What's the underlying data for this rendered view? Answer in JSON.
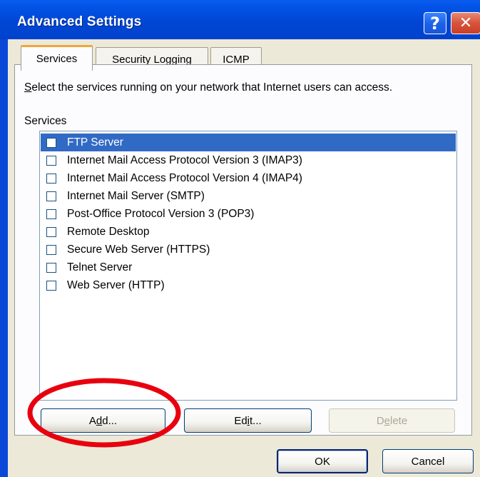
{
  "window": {
    "title": "Advanced Settings",
    "help_glyph": "?",
    "close_glyph": "✕"
  },
  "tabs": [
    {
      "label": "Services",
      "active": true
    },
    {
      "label": "Security Logging",
      "active": false
    },
    {
      "label": "ICMP",
      "active": false
    }
  ],
  "instruction": {
    "prefix": "",
    "mnemonic": "S",
    "rest": "elect the services running on your network that Internet users can access."
  },
  "services_label": "Services",
  "services": [
    {
      "label": "FTP Server",
      "checked": false,
      "selected": true
    },
    {
      "label": "Internet Mail Access Protocol Version 3 (IMAP3)",
      "checked": false,
      "selected": false
    },
    {
      "label": "Internet Mail Access Protocol Version 4 (IMAP4)",
      "checked": false,
      "selected": false
    },
    {
      "label": "Internet Mail Server (SMTP)",
      "checked": false,
      "selected": false
    },
    {
      "label": "Post-Office Protocol Version 3 (POP3)",
      "checked": false,
      "selected": false
    },
    {
      "label": "Remote Desktop",
      "checked": false,
      "selected": false
    },
    {
      "label": "Secure Web Server (HTTPS)",
      "checked": false,
      "selected": false
    },
    {
      "label": "Telnet Server",
      "checked": false,
      "selected": false
    },
    {
      "label": "Web Server (HTTP)",
      "checked": false,
      "selected": false
    }
  ],
  "buttons": {
    "add": {
      "before": "A",
      "mnemonic": "d",
      "after": "d..."
    },
    "edit": {
      "before": "Ed",
      "mnemonic": "i",
      "after": "t..."
    },
    "delete": {
      "before": "D",
      "mnemonic": "e",
      "after": "lete",
      "enabled": false
    },
    "ok": "OK",
    "cancel": "Cancel"
  },
  "colors": {
    "titlebar": "#0046d5",
    "selection": "#316ac5",
    "annotation_circle": "#e8000f"
  }
}
